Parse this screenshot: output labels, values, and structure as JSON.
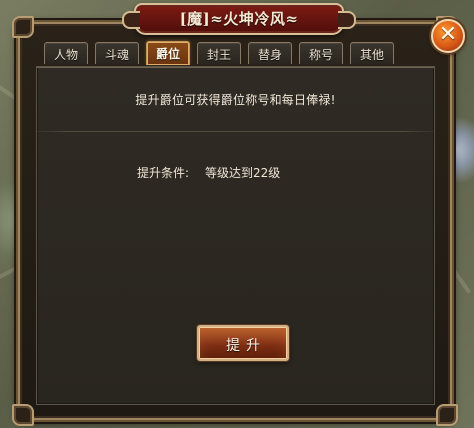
{
  "window": {
    "title": "[魔]≈火坤冷风≈"
  },
  "tabs": [
    {
      "label": "人物",
      "active": false
    },
    {
      "label": "斗魂",
      "active": false
    },
    {
      "label": "爵位",
      "active": true
    },
    {
      "label": "封王",
      "active": false
    },
    {
      "label": "替身",
      "active": false
    },
    {
      "label": "称号",
      "active": false
    },
    {
      "label": "其他",
      "active": false
    }
  ],
  "content": {
    "intro": "提升爵位可获得爵位称号和每日俸禄!",
    "requirement_label": "提升条件:",
    "requirement_value": "等级达到22级",
    "promote_button_label": "提升"
  },
  "icons": {
    "close": "close-icon"
  },
  "colors": {
    "active_tab": "#7a3f14",
    "panel_bg": "#2c2722",
    "close_button": "#d95b17"
  }
}
